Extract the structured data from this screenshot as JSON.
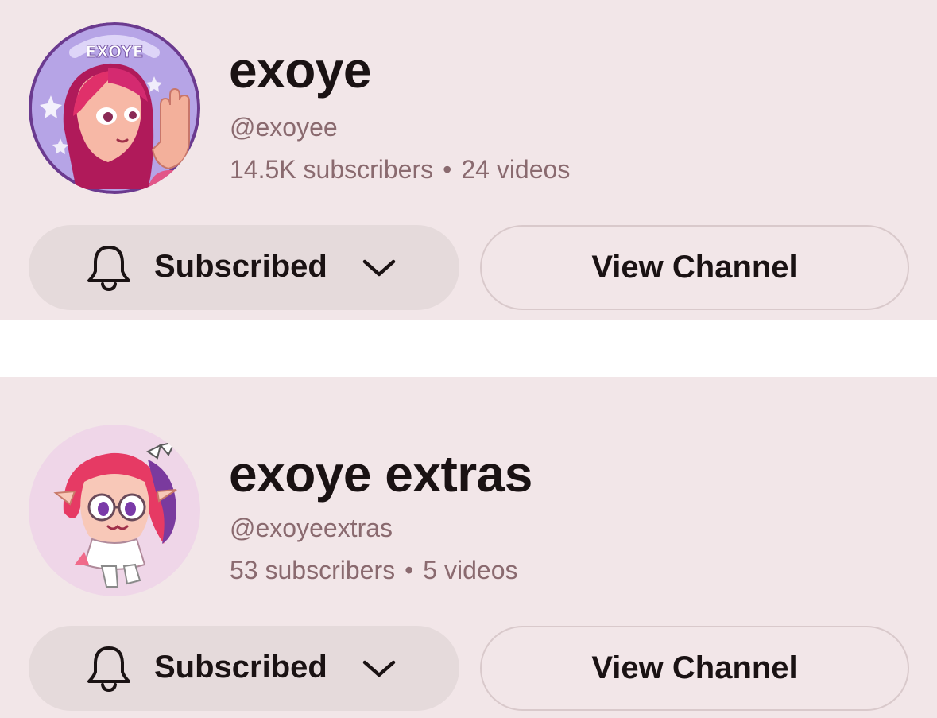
{
  "channels": [
    {
      "name": "exoye",
      "handle": "@exoyee",
      "subscribers": "14.5K subscribers",
      "separator": "•",
      "videos": "24 videos",
      "subscribe_label": "Subscribed",
      "view_label": "View Channel",
      "avatar_text": "EXOYE"
    },
    {
      "name": "exoye extras",
      "handle": "@exoyeextras",
      "subscribers": "53 subscribers",
      "separator": "•",
      "videos": "5 videos",
      "subscribe_label": "Subscribed",
      "view_label": "View Channel"
    }
  ],
  "icons": {
    "subscribe": "bell-icon",
    "dropdown": "chevron-down-icon"
  },
  "colors": {
    "card_background": "#f2e6e8",
    "primary_text": "#1a1213",
    "secondary_text": "#8a6a6f",
    "subscribed_button": "#e5dadb",
    "outline_button_border": "#d9c9cb"
  }
}
